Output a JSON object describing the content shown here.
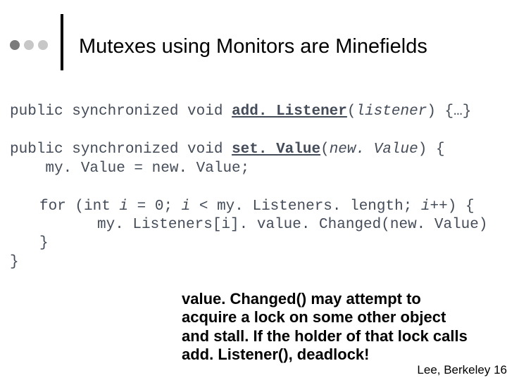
{
  "header": {
    "title": "Mutexes using Monitors are Minefields"
  },
  "code": {
    "l1_pre": "public synchronized void ",
    "l1_fn": "add. Listener",
    "l1_open": "(",
    "l1_arg": "listener",
    "l1_close": ") {…}",
    "l2_pre": "public synchronized void ",
    "l2_fn": "set. Value",
    "l2_open": "(",
    "l2_arg": "new. Value",
    "l2_close": ") {",
    "l3": "    my. Value = new. Value;",
    "l4_a": "for (int ",
    "l4_i": "i",
    "l4_b": " = 0; ",
    "l4_i2": "i",
    "l4_c": " < my. Listeners. length; ",
    "l4_i3": "i",
    "l4_d": "++) {",
    "l5": "my. Listeners[i]. value. Changed(new. Value)",
    "l6": "}",
    "l7": "}"
  },
  "callout": "value. Changed() may attempt to acquire a lock on some other object and stall. If the holder of that lock calls add. Listener(), deadlock!",
  "footer": "Lee, Berkeley 16"
}
